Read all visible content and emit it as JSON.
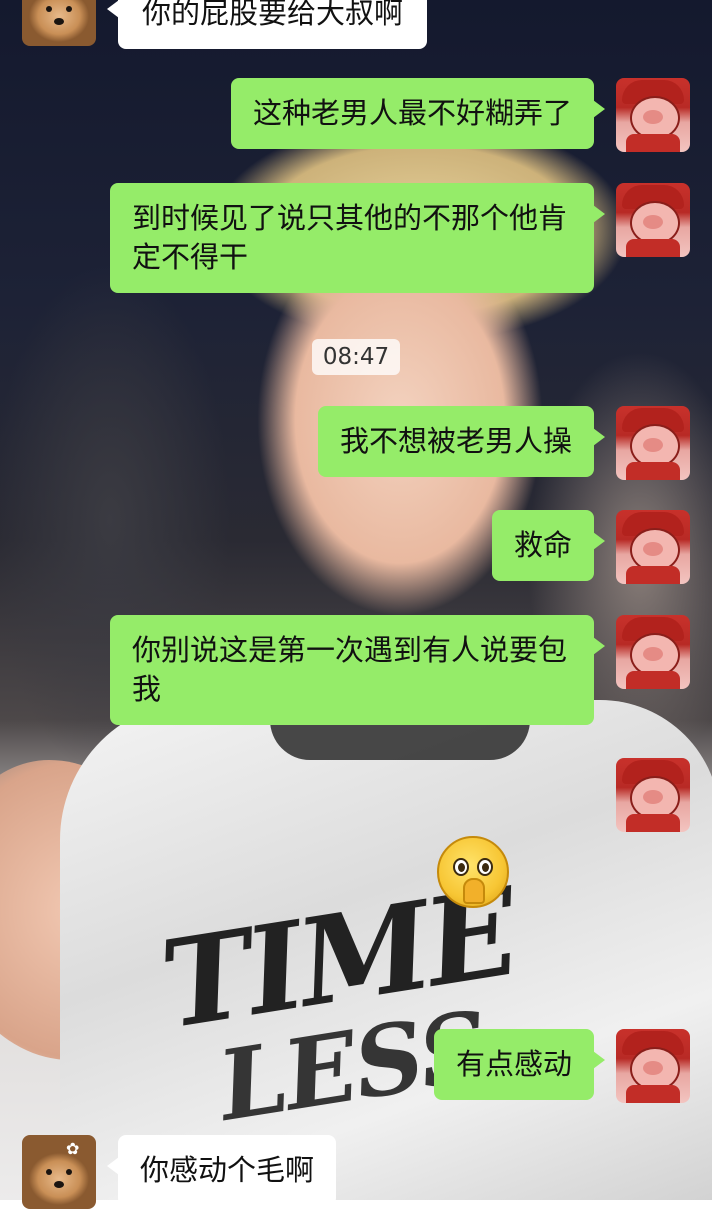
{
  "messages": [
    {
      "id": "m1",
      "side": "received",
      "text": "你的屁股要给大叔啊",
      "avatar": "dog-avatar"
    },
    {
      "id": "m2",
      "side": "sent",
      "text": "这种老男人最不好糊弄了",
      "avatar": "pig-avatar"
    },
    {
      "id": "m3",
      "side": "sent",
      "text": "到时候见了说只其他的不那个他肯定不得干",
      "avatar": "pig-avatar"
    },
    {
      "id": "m4",
      "side": "sent",
      "text": "我不想被老男人操",
      "avatar": "pig-avatar"
    },
    {
      "id": "m5",
      "side": "sent",
      "text": "救命",
      "avatar": "pig-avatar"
    },
    {
      "id": "m6",
      "side": "sent",
      "text": "你别说这是第一次遇到有人说要包我",
      "avatar": "pig-avatar"
    },
    {
      "id": "m7",
      "side": "sent",
      "type": "sticker",
      "sticker": "pleading-face-emoji",
      "avatar": "pig-avatar"
    },
    {
      "id": "m8",
      "side": "sent",
      "text": "有点感动",
      "avatar": "pig-avatar"
    },
    {
      "id": "m9",
      "side": "received",
      "text": "你感动个毛啊",
      "avatar": "dog-avatar"
    }
  ],
  "timestamp": "08:47",
  "background_text": {
    "line1": "TIME",
    "line2": "LESS"
  },
  "colors": {
    "sent_bubble": "#95ec69",
    "received_bubble": "#ffffff"
  }
}
